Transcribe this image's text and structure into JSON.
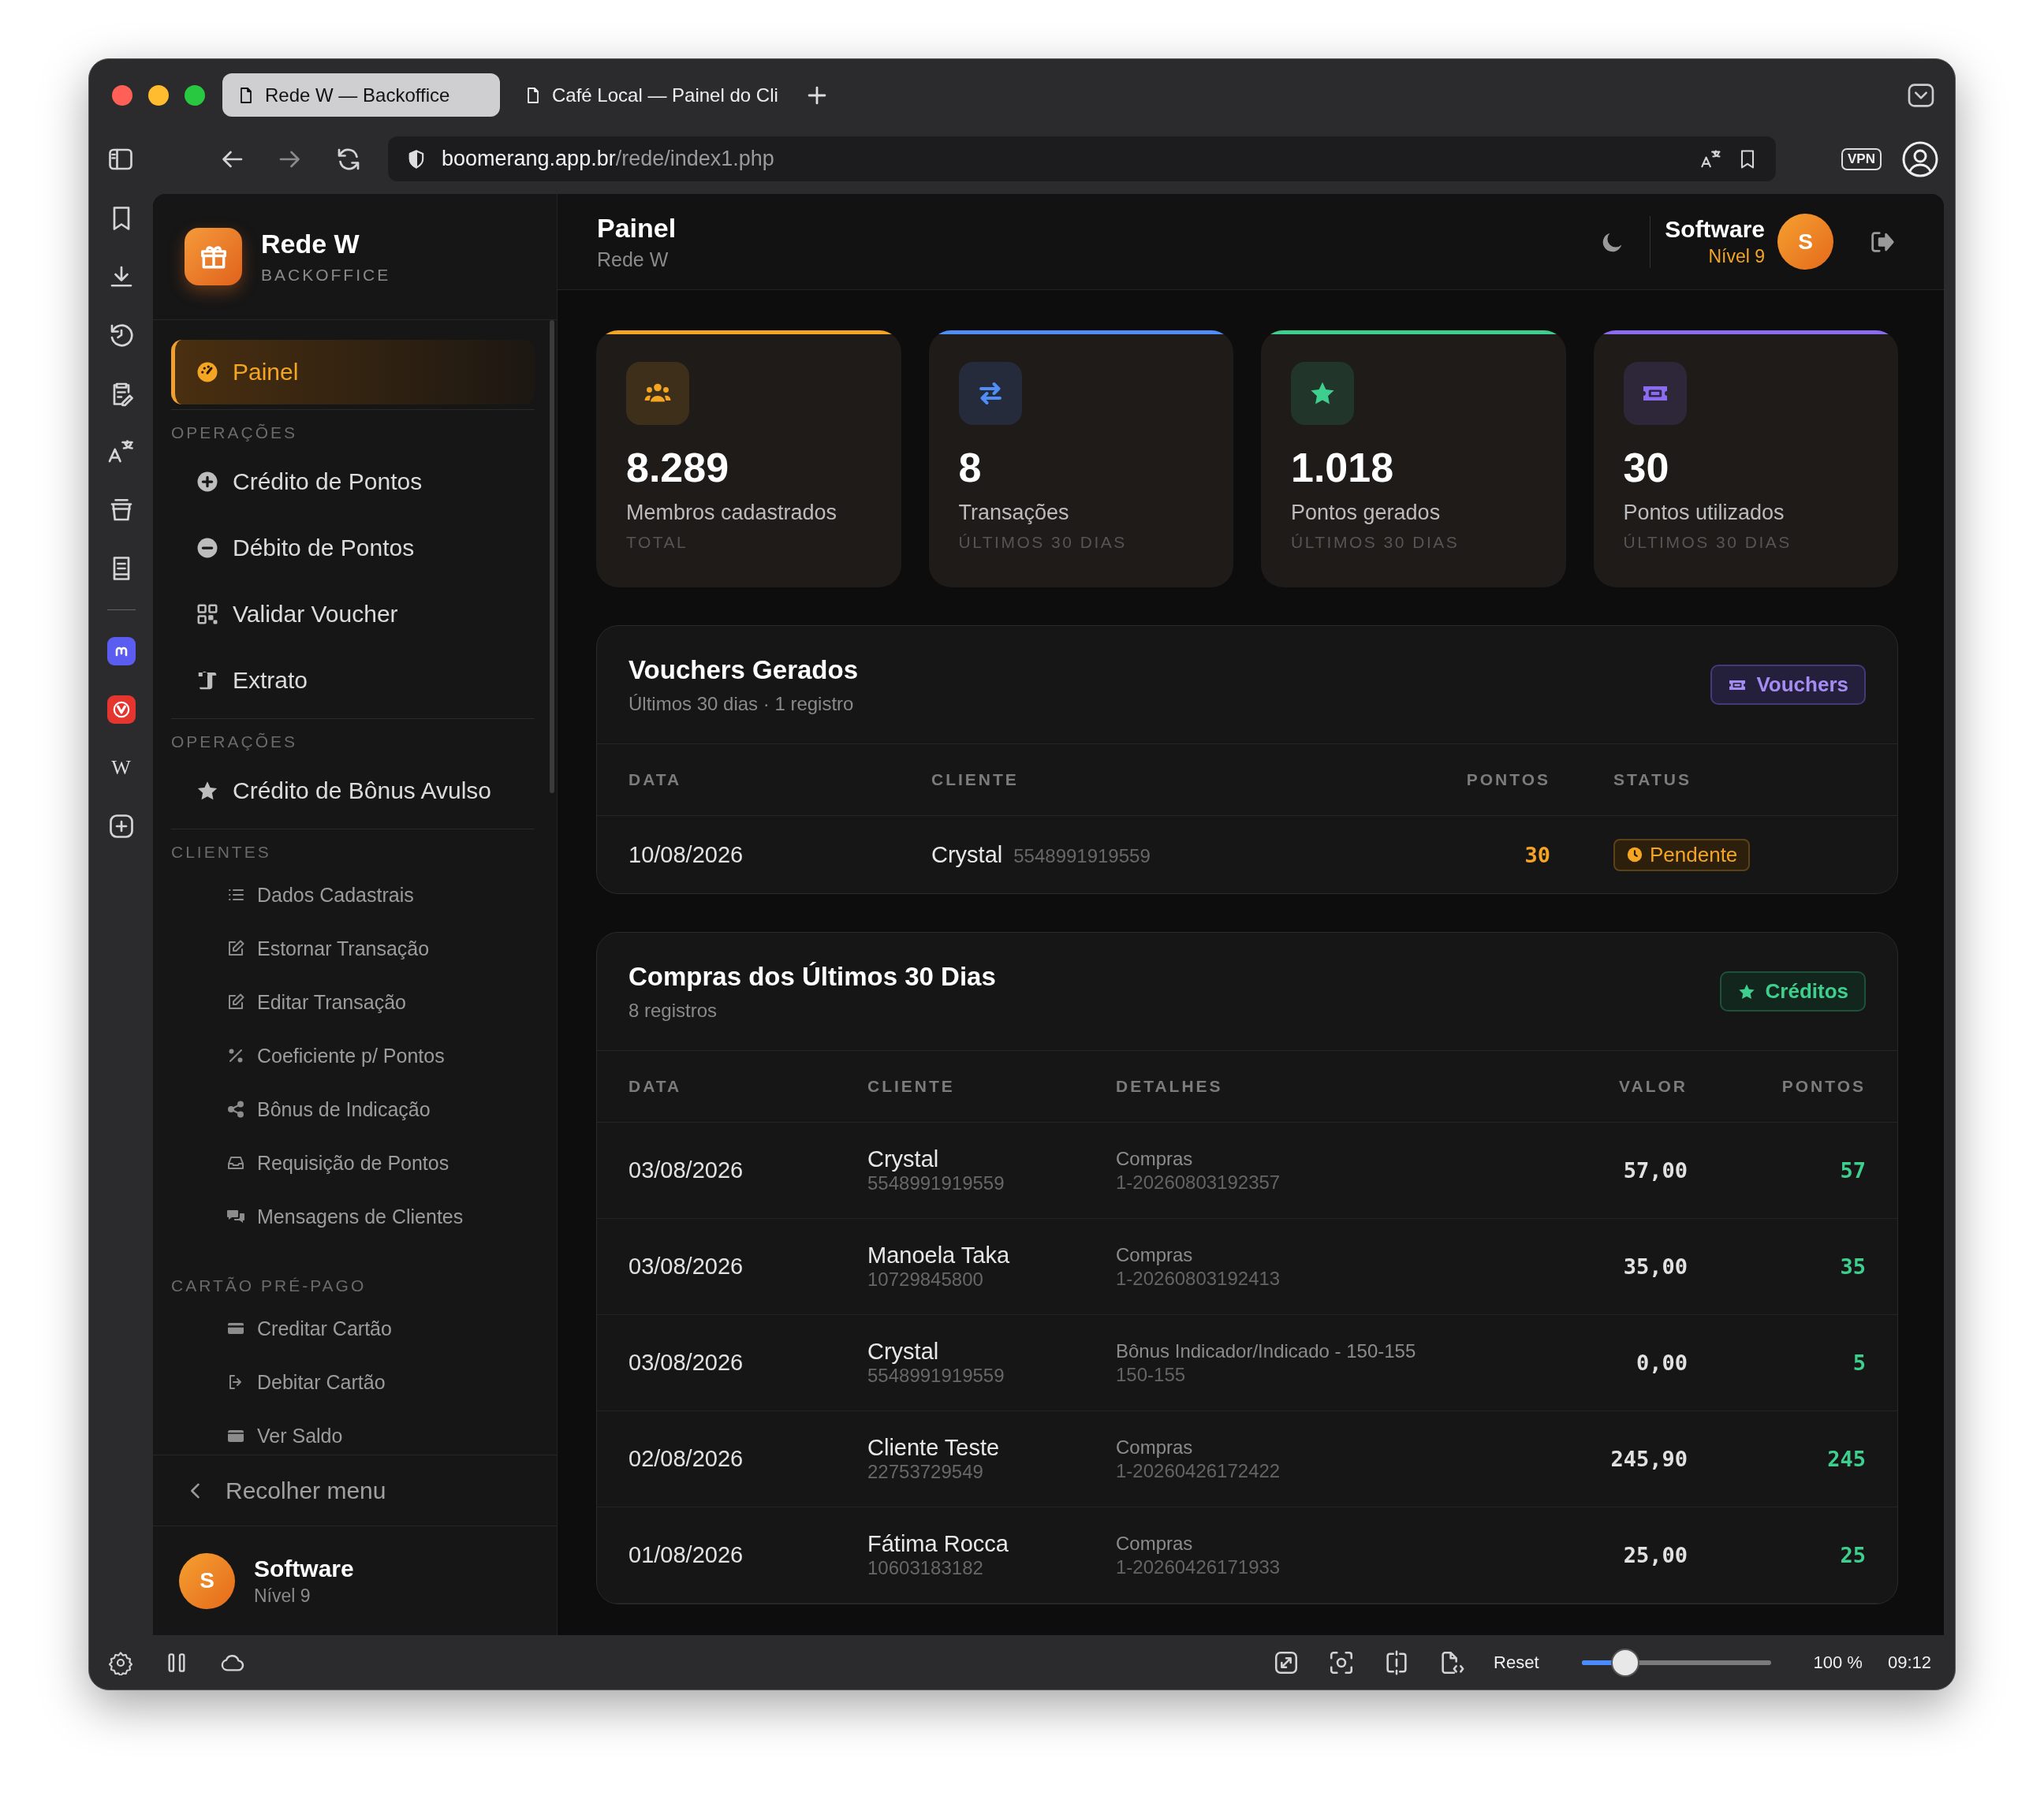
{
  "browser": {
    "tabs": [
      {
        "title": "Rede W — Backoffice",
        "selected": true
      },
      {
        "title": "Café Local — Painel do Cli",
        "selected": false
      }
    ],
    "url_host": "boomerang.app.br",
    "url_path": "/rede/index1.php",
    "vpn": "VPN",
    "wiki": "W"
  },
  "sidebar": {
    "brand": {
      "title": "Rede W",
      "subtitle": "BACKOFFICE"
    },
    "nav": [
      {
        "kind": "link",
        "label": "Painel",
        "selected": true
      },
      {
        "kind": "divider"
      },
      {
        "kind": "heading",
        "label": "OPERAÇÕES"
      },
      {
        "kind": "link",
        "label": "Crédito de Pontos",
        "selected": false
      },
      {
        "kind": "link",
        "label": "Débito de Pontos",
        "selected": false
      },
      {
        "kind": "link",
        "label": "Validar Voucher",
        "selected": false
      },
      {
        "kind": "link",
        "label": "Extrato",
        "selected": false
      },
      {
        "kind": "divider"
      },
      {
        "kind": "heading",
        "label": "OPERAÇÕES"
      },
      {
        "kind": "link",
        "label": "Crédito de Bônus Avulso",
        "selected": false
      },
      {
        "kind": "divider"
      },
      {
        "kind": "heading",
        "label": "CLIENTES"
      },
      {
        "kind": "sublink",
        "label": "Dados Cadastrais",
        "selected": false
      },
      {
        "kind": "sublink",
        "label": "Estornar Transação",
        "selected": false
      },
      {
        "kind": "sublink",
        "label": "Editar Transação",
        "selected": false
      },
      {
        "kind": "sublink",
        "label": "Coeficiente p/ Pontos",
        "selected": false
      },
      {
        "kind": "sublink",
        "label": "Bônus de Indicação",
        "selected": false
      },
      {
        "kind": "sublink",
        "label": "Requisição de Pontos",
        "selected": false
      },
      {
        "kind": "sublink",
        "label": "Mensagens de Clientes",
        "selected": false
      },
      {
        "kind": "heading",
        "label": "CARTÃO PRÉ-PAGO"
      },
      {
        "kind": "sublink",
        "label": "Creditar Cartão",
        "selected": false
      },
      {
        "kind": "sublink",
        "label": "Debitar Cartão",
        "selected": false
      },
      {
        "kind": "sublink",
        "label": "Ver Saldo",
        "selected": false
      }
    ],
    "collapse": "Recolher menu",
    "user": {
      "initial": "S",
      "name": "Software",
      "level": "Nível 9"
    }
  },
  "header": {
    "title": "Painel",
    "subtitle": "Rede W",
    "user_name": "Software",
    "user_level": "Nível 9",
    "initial": "S"
  },
  "stats": [
    {
      "value": "8.289",
      "label": "Membros cadastrados",
      "period": "TOTAL",
      "color": "#f5a524"
    },
    {
      "value": "8",
      "label": "Transações",
      "period": "ÚLTIMOS 30 DIAS",
      "color": "#4f8ef7"
    },
    {
      "value": "1.018",
      "label": "Pontos gerados",
      "period": "ÚLTIMOS 30 DIAS",
      "color": "#3ecf8e"
    },
    {
      "value": "30",
      "label": "Pontos utilizados",
      "period": "ÚLTIMOS 30 DIAS",
      "color": "#8b6cf0"
    }
  ],
  "vouchers": {
    "title": "Vouchers Gerados",
    "subtitle": "Últimos 30 dias · 1 registro",
    "button": "Vouchers",
    "columns": [
      "DATA",
      "CLIENTE",
      "PONTOS",
      "STATUS"
    ],
    "rows": [
      {
        "date": "10/08/2026",
        "client": "Crystal",
        "phone": "5548991919559",
        "points": "30",
        "status": "Pendente",
        "pending": true
      }
    ]
  },
  "purchases": {
    "title": "Compras dos Últimos 30 Dias",
    "subtitle": "8 registros",
    "button": "Créditos",
    "columns": [
      "DATA",
      "CLIENTE",
      "DETALHES",
      "VALOR",
      "PONTOS"
    ],
    "rows": [
      {
        "date": "03/08/2026",
        "client": "Crystal",
        "phone": "5548991919559",
        "detail": "Compras",
        "reference": "1-20260803192357",
        "value": "57,00",
        "points": "57"
      },
      {
        "date": "03/08/2026",
        "client": "Manoela Taka",
        "phone": "10729845800",
        "detail": "Compras",
        "reference": "1-20260803192413",
        "value": "35,00",
        "points": "35"
      },
      {
        "date": "03/08/2026",
        "client": "Crystal",
        "phone": "5548991919559",
        "detail": "Bônus Indicador/Indicado - 150-155",
        "reference": "150-155",
        "value": "0,00",
        "points": "5"
      },
      {
        "date": "02/08/2026",
        "client": "Cliente Teste",
        "phone": "22753729549",
        "detail": "Compras",
        "reference": "1-20260426172422",
        "value": "245,90",
        "points": "245"
      },
      {
        "date": "01/08/2026",
        "client": "Fátima Rocca",
        "phone": "10603183182",
        "detail": "Compras",
        "reference": "1-20260426171933",
        "value": "25,00",
        "points": "25"
      }
    ]
  },
  "statusbar": {
    "reset": "Reset",
    "zoom": {
      "level": 0.2
    },
    "zoom_text": "100 %",
    "time": "09:12"
  }
}
